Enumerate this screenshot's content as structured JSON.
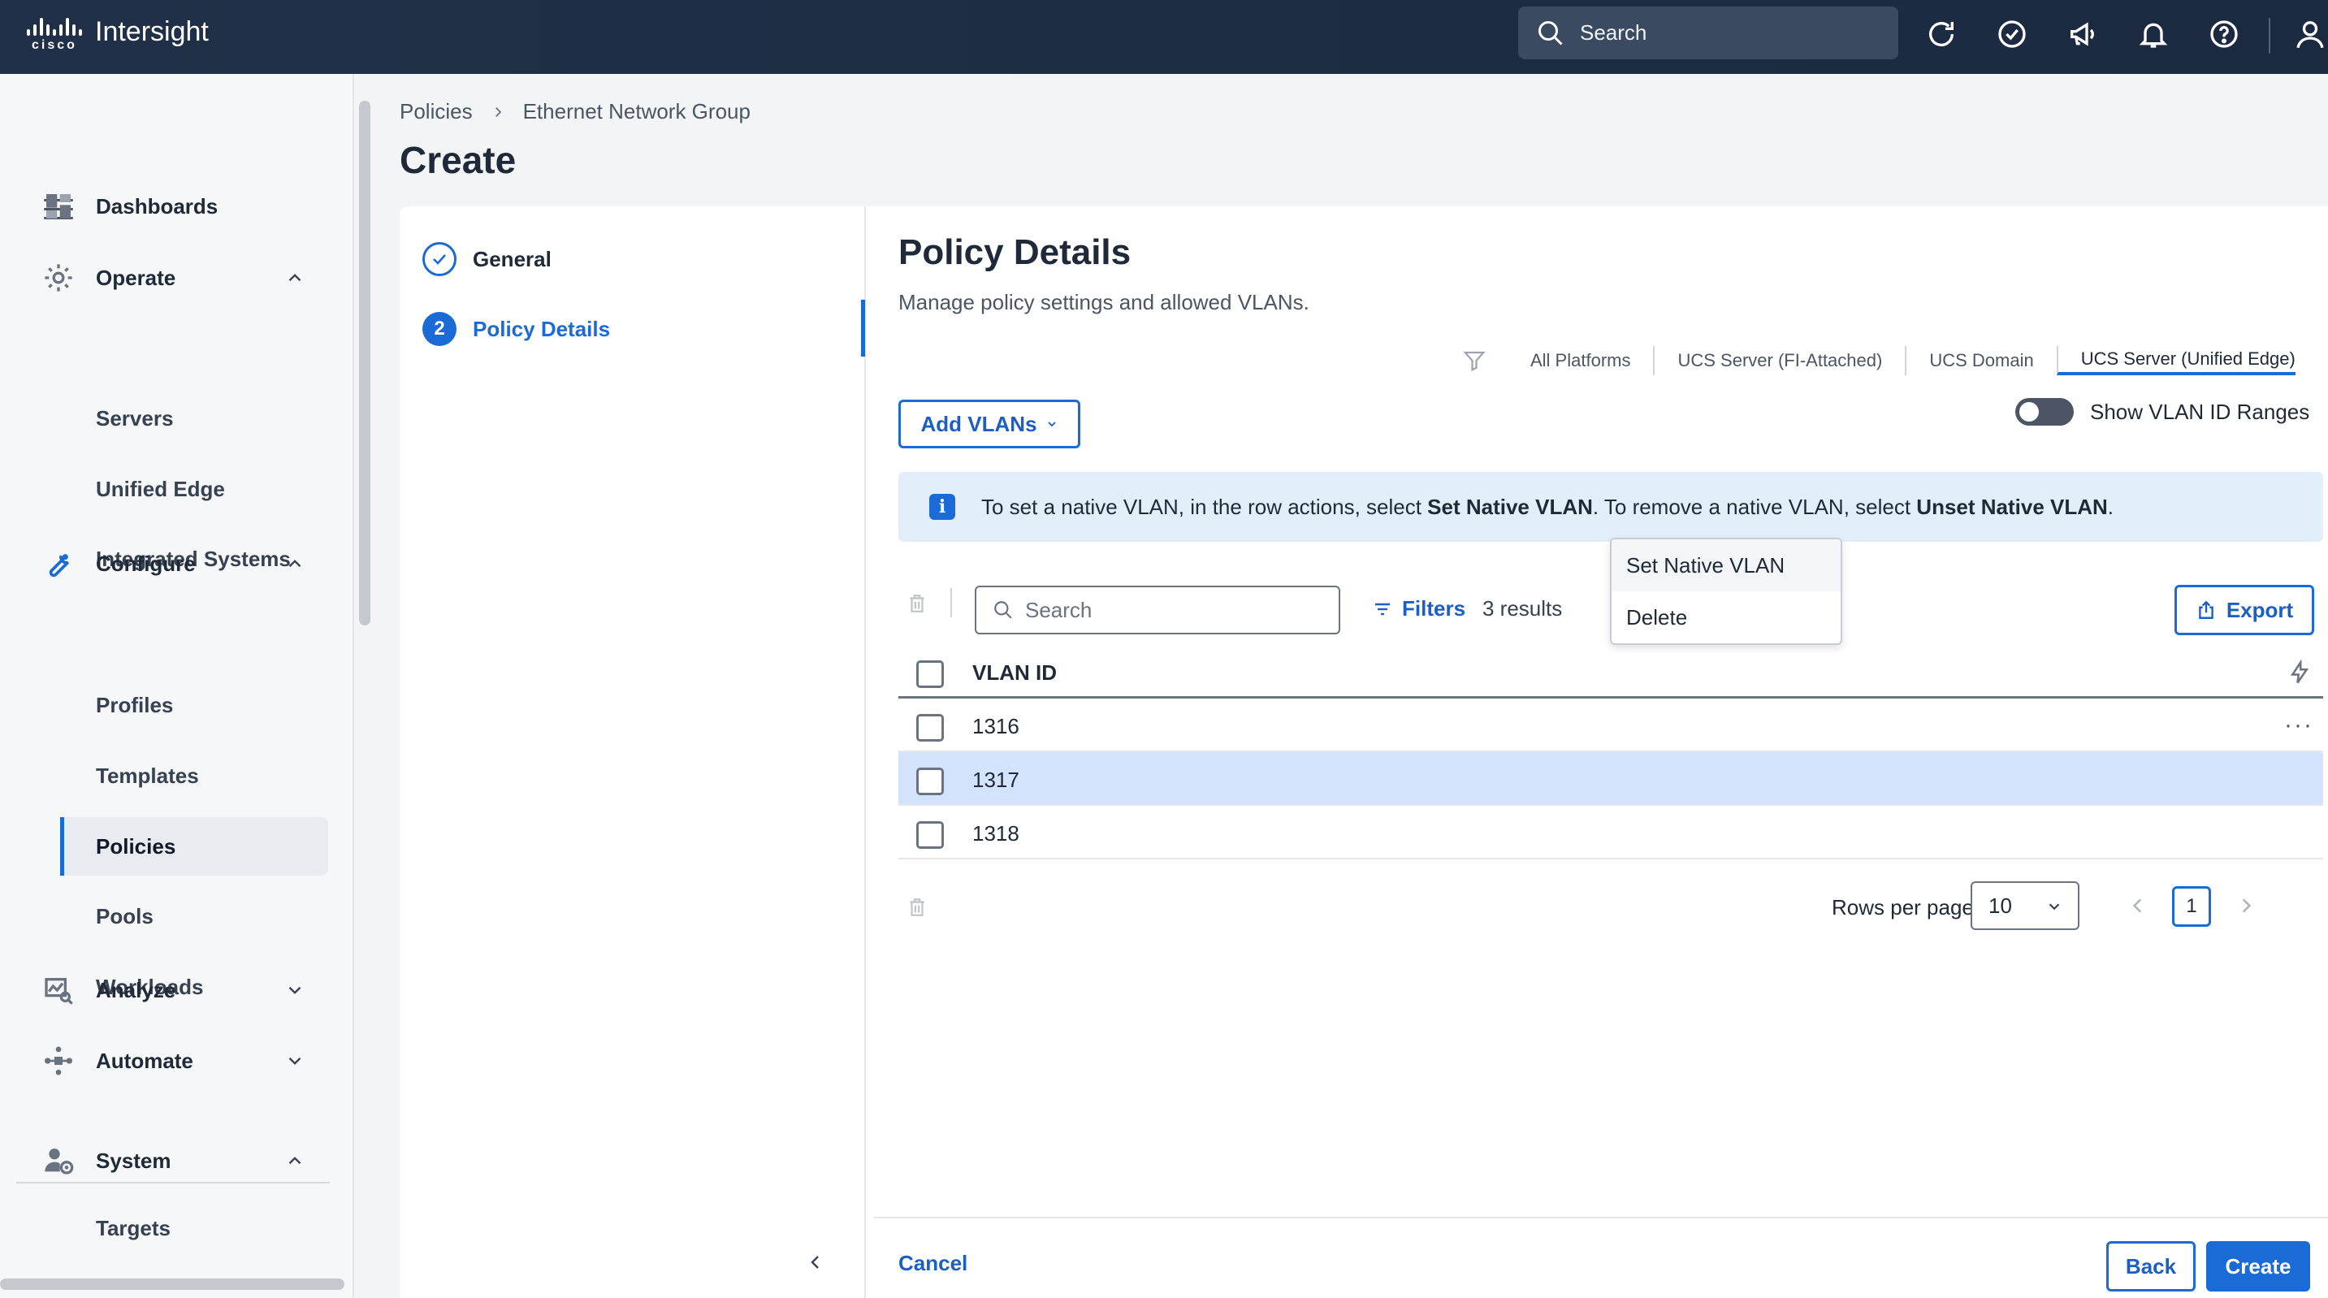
{
  "app": {
    "brand_word": "cisco",
    "title": "Intersight",
    "search_label": "Search"
  },
  "sidebar": {
    "items": [
      {
        "label": "Dashboards"
      },
      {
        "label": "Operate"
      },
      {
        "label": "Servers"
      },
      {
        "label": "Unified Edge"
      },
      {
        "label": "Integrated Systems"
      },
      {
        "label": "Configure"
      },
      {
        "label": "Profiles"
      },
      {
        "label": "Templates"
      },
      {
        "label": "Policies"
      },
      {
        "label": "Pools"
      },
      {
        "label": "Workloads"
      },
      {
        "label": "Analyze"
      },
      {
        "label": "Automate"
      },
      {
        "label": "System"
      },
      {
        "label": "Targets"
      }
    ]
  },
  "breadcrumb": {
    "parent": "Policies",
    "current": "Ethernet Network Group"
  },
  "page": {
    "title": "Create"
  },
  "wizard": {
    "steps": [
      {
        "number": "",
        "label": "General",
        "state": "done"
      },
      {
        "number": "2",
        "label": "Policy Details",
        "state": "active"
      }
    ]
  },
  "details": {
    "title": "Policy Details",
    "subtitle": "Manage policy settings and allowed VLANs.",
    "platforms": [
      "All Platforms",
      "UCS Server (FI-Attached)",
      "UCS Domain",
      "UCS Server (Unified Edge)"
    ],
    "add_vlans_label": "Add VLANs",
    "toggle_label": "Show VLAN ID Ranges",
    "info": {
      "part1": "To set a native VLAN, in the row actions, select ",
      "bold1": "Set Native VLAN",
      "part2": ". To remove a native VLAN, select ",
      "bold2": "Unset Native VLAN",
      "part3": "."
    }
  },
  "table": {
    "search_placeholder": "Search",
    "filters_label": "Filters",
    "results_text": "3 results",
    "export_label": "Export",
    "column_header": "VLAN ID",
    "rows": [
      {
        "vlan_id": "1316"
      },
      {
        "vlan_id": "1317"
      },
      {
        "vlan_id": "1318"
      }
    ],
    "row_menu": [
      "Set Native VLAN",
      "Delete"
    ],
    "rows_per_page_label": "Rows per page",
    "rows_per_page_value": "10",
    "current_page": "1"
  },
  "footer": {
    "cancel_label": "Cancel",
    "back_label": "Back",
    "create_label": "Create"
  },
  "colors": {
    "accent": "#1b6bd6",
    "topbar": "#1f3048",
    "selected_row": "#d3e3fb",
    "info_bg": "#e3eefb"
  }
}
